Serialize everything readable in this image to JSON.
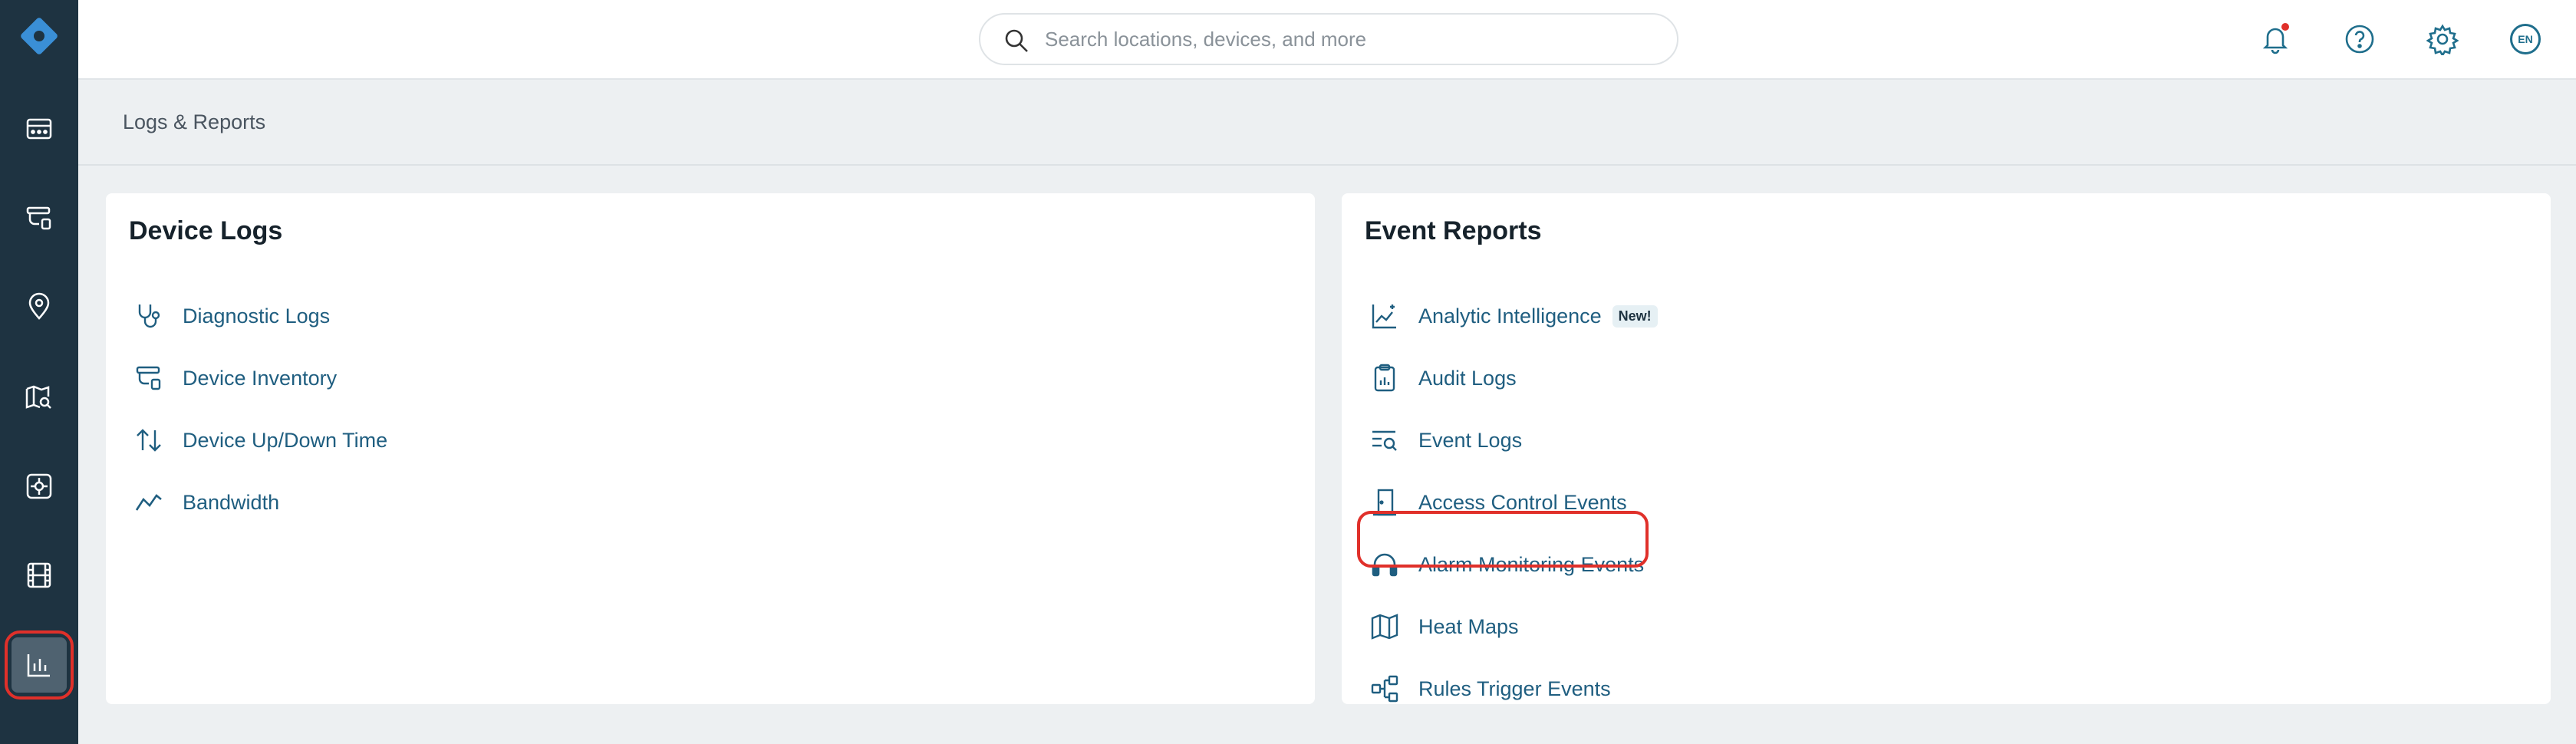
{
  "header": {
    "search": {
      "placeholder": "Search locations, devices, and more",
      "value": ""
    },
    "language": "EN"
  },
  "breadcrumb": "Logs & Reports",
  "sidebar": {
    "items": [
      {
        "name": "dashboard",
        "icon": "dashboard-grid-icon"
      },
      {
        "name": "devices",
        "icon": "camera-device-icon"
      },
      {
        "name": "locations",
        "icon": "location-pin-icon"
      },
      {
        "name": "maps",
        "icon": "map-search-icon"
      },
      {
        "name": "apps",
        "icon": "app-tile-icon"
      },
      {
        "name": "video",
        "icon": "film-icon"
      },
      {
        "name": "reports",
        "icon": "bar-chart-icon",
        "active": true
      }
    ]
  },
  "device_logs": {
    "title": "Device Logs",
    "items": [
      {
        "label": "Diagnostic Logs",
        "icon": "stethoscope-icon"
      },
      {
        "label": "Device Inventory",
        "icon": "device-inventory-icon"
      },
      {
        "label": "Device Up/Down Time",
        "icon": "up-down-arrows-icon"
      },
      {
        "label": "Bandwidth",
        "icon": "line-trend-icon"
      }
    ]
  },
  "event_reports": {
    "title": "Event Reports",
    "items": [
      {
        "label": "Analytic Intelligence",
        "icon": "analytics-sparkle-icon",
        "badge": "New!"
      },
      {
        "label": "Audit Logs",
        "icon": "clipboard-chart-icon"
      },
      {
        "label": "Event Logs",
        "icon": "list-search-icon"
      },
      {
        "label": "Access Control Events",
        "icon": "door-icon"
      },
      {
        "label": "Alarm Monitoring Events",
        "icon": "headset-icon",
        "highlighted": true
      },
      {
        "label": "Heat Maps",
        "icon": "folded-map-icon"
      },
      {
        "label": "Rules Trigger Events",
        "icon": "flow-nodes-icon"
      }
    ]
  },
  "colors": {
    "sidebar": "#1e3341",
    "link": "#1f5e80",
    "highlight": "#e0302a",
    "background": "#edf0f2"
  }
}
